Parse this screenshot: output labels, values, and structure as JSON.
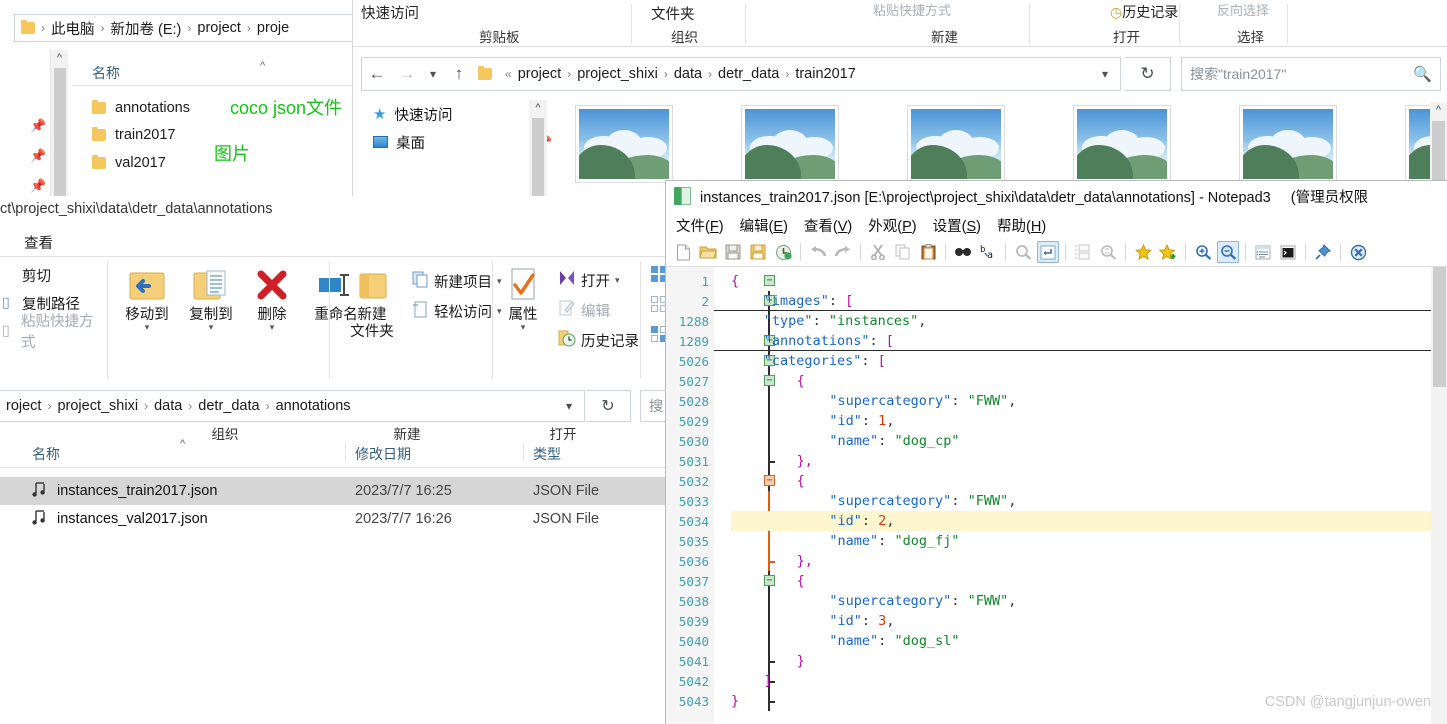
{
  "window1": {
    "breadcrumb": [
      "此电脑",
      "新加卷 (E:)",
      "project",
      "proje"
    ],
    "column_header": "名称",
    "items": [
      {
        "name": "annotations"
      },
      {
        "name": "train2017"
      },
      {
        "name": "val2017"
      }
    ],
    "annotations": [
      {
        "text": "coco json文件",
        "color": "#14c414"
      },
      {
        "text": "图片",
        "color": "#14c414"
      }
    ]
  },
  "window2": {
    "ribbon": {
      "quick_access": "快速访问",
      "paste_shortcut": "粘贴快捷方式",
      "groups": [
        "剪贴板",
        "组织",
        "新建",
        "打开",
        "选择"
      ],
      "folder_label": "文件夹",
      "history_label": "历史记录",
      "invert_label": "反向选择"
    },
    "breadcrumb": [
      "project",
      "project_shixi",
      "data",
      "detr_data",
      "train2017"
    ],
    "search_placeholder": "搜索\"train2017\"",
    "nav": [
      {
        "label": "快速访问",
        "icon": "star-icon"
      },
      {
        "label": "桌面",
        "icon": "desktop-icon"
      }
    ],
    "thumbnail_count": 6
  },
  "window3": {
    "title_path": "ct\\project_shixi\\data\\detr_data\\annotations",
    "tab": "查看",
    "clipboard": [
      {
        "label": "剪切",
        "enabled": true
      },
      {
        "label": "复制路径",
        "enabled": true
      },
      {
        "label": "粘贴快捷方式",
        "enabled": false
      }
    ],
    "big_buttons": [
      {
        "label": "移动到",
        "icon": "move-to-icon",
        "caret": true
      },
      {
        "label": "复制到",
        "icon": "copy-to-icon",
        "caret": true
      },
      {
        "label": "删除",
        "icon": "delete-icon",
        "caret": true
      },
      {
        "label": "重命名",
        "icon": "rename-icon",
        "caret": false
      },
      {
        "label": "新建\n文件夹",
        "icon": "new-folder-icon",
        "caret": false
      },
      {
        "label": "属性",
        "icon": "properties-icon",
        "caret": true
      }
    ],
    "new_items": [
      {
        "label": "新建项目",
        "icon": "new-item-icon",
        "enabled": true,
        "caret": true
      },
      {
        "label": "轻松访问",
        "icon": "easy-access-icon",
        "enabled": true,
        "caret": true
      }
    ],
    "open_items": [
      {
        "label": "打开",
        "icon": "open-icon",
        "enabled": true,
        "caret": true
      },
      {
        "label": "编辑",
        "icon": "edit-icon",
        "enabled": false,
        "caret": false
      },
      {
        "label": "历史记录",
        "icon": "history-icon",
        "enabled": true,
        "caret": false
      }
    ],
    "group_labels": [
      "组织",
      "新建",
      "打开"
    ],
    "breadcrumb": [
      "roject",
      "project_shixi",
      "data",
      "detr_data",
      "annotations"
    ],
    "search_placeholder": "搜",
    "columns": [
      "名称",
      "修改日期",
      "类型"
    ],
    "rows": [
      {
        "name": "instances_train2017.json",
        "modified": "2023/7/7 16:25",
        "type": "JSON File",
        "selected": true
      },
      {
        "name": "instances_val2017.json",
        "modified": "2023/7/7 16:26",
        "type": "JSON File",
        "selected": false
      }
    ]
  },
  "notepad": {
    "title": "instances_train2017.json [E:\\project\\project_shixi\\data\\detr_data\\annotations] - Notepad3",
    "admin_suffix": "(管理员权限",
    "menus": [
      {
        "label": "文件",
        "accel": "F"
      },
      {
        "label": "编辑",
        "accel": "E"
      },
      {
        "label": "查看",
        "accel": "V"
      },
      {
        "label": "外观",
        "accel": "P"
      },
      {
        "label": "设置",
        "accel": "S"
      },
      {
        "label": "帮助",
        "accel": "H"
      }
    ],
    "toolbar_icons": [
      "new-file-icon",
      "open-file-icon",
      "save-icon",
      "save-as-icon",
      "revert-icon",
      "sep",
      "undo-icon",
      "redo-icon",
      "sep",
      "cut-icon",
      "copy-icon",
      "paste-icon",
      "sep",
      "find-icon",
      "replace-icon",
      "sep",
      "find-next-icon",
      "toggle-eol-icon",
      "sep",
      "block-select-icon",
      "zoom-find-icon",
      "sep",
      "bookmark-icon",
      "add-bookmark-icon",
      "sep",
      "zoom-in-icon",
      "zoom-out-icon",
      "sep",
      "word-wrap-icon",
      "console-icon",
      "sep",
      "always-on-top-icon",
      "sep",
      "exit-icon"
    ],
    "active_toolbar_icons": [
      "toggle-eol-icon",
      "zoom-out-icon"
    ],
    "lines": [
      {
        "num": "1",
        "indent": 0,
        "fold": "minus",
        "tokens": [
          {
            "t": "{",
            "c": "brace"
          }
        ]
      },
      {
        "num": "2",
        "indent": 1,
        "fold": "plus",
        "tokens": [
          {
            "t": "\"images\"",
            "c": "key"
          },
          {
            "t": ": ",
            "c": "punc"
          },
          {
            "t": "[",
            "c": "brace"
          }
        ],
        "rule_below": true
      },
      {
        "num": "1288",
        "indent": 1,
        "fold": "none",
        "tokens": [
          {
            "t": "\"type\"",
            "c": "key"
          },
          {
            "t": ": ",
            "c": "punc"
          },
          {
            "t": "\"instances\"",
            "c": "str"
          },
          {
            "t": ",",
            "c": "punc"
          }
        ]
      },
      {
        "num": "1289",
        "indent": 1,
        "fold": "plus",
        "tokens": [
          {
            "t": "\"annotations\"",
            "c": "key"
          },
          {
            "t": ": ",
            "c": "punc"
          },
          {
            "t": "[",
            "c": "brace"
          }
        ],
        "rule_below": true
      },
      {
        "num": "5026",
        "indent": 1,
        "fold": "minus",
        "tokens": [
          {
            "t": "\"categories\"",
            "c": "key"
          },
          {
            "t": ": ",
            "c": "punc"
          },
          {
            "t": "[",
            "c": "brace"
          }
        ]
      },
      {
        "num": "5027",
        "indent": 2,
        "fold": "minus",
        "tokens": [
          {
            "t": "{",
            "c": "brace"
          }
        ]
      },
      {
        "num": "5028",
        "indent": 3,
        "fold": "none",
        "tokens": [
          {
            "t": "\"supercategory\"",
            "c": "key"
          },
          {
            "t": ": ",
            "c": "punc"
          },
          {
            "t": "\"FWW\"",
            "c": "str"
          },
          {
            "t": ",",
            "c": "punc"
          }
        ]
      },
      {
        "num": "5029",
        "indent": 3,
        "fold": "none",
        "tokens": [
          {
            "t": "\"id\"",
            "c": "key"
          },
          {
            "t": ": ",
            "c": "punc"
          },
          {
            "t": "1",
            "c": "num"
          },
          {
            "t": ",",
            "c": "punc"
          }
        ]
      },
      {
        "num": "5030",
        "indent": 3,
        "fold": "none",
        "tokens": [
          {
            "t": "\"name\"",
            "c": "key"
          },
          {
            "t": ": ",
            "c": "punc"
          },
          {
            "t": "\"dog_cp\"",
            "c": "str"
          }
        ]
      },
      {
        "num": "5031",
        "indent": 2,
        "fold": "tick",
        "tokens": [
          {
            "t": "},",
            "c": "brace"
          }
        ]
      },
      {
        "num": "5032",
        "indent": 2,
        "fold": "minus-orange",
        "tokens": [
          {
            "t": "{",
            "c": "brace"
          }
        ]
      },
      {
        "num": "5033",
        "indent": 3,
        "fold": "none",
        "tokens": [
          {
            "t": "\"supercategory\"",
            "c": "key"
          },
          {
            "t": ": ",
            "c": "punc"
          },
          {
            "t": "\"FWW\"",
            "c": "str"
          },
          {
            "t": ",",
            "c": "punc"
          }
        ]
      },
      {
        "num": "5034",
        "indent": 3,
        "fold": "none",
        "highlight": true,
        "tokens": [
          {
            "t": "\"id\"",
            "c": "key"
          },
          {
            "t": ": ",
            "c": "punc"
          },
          {
            "t": "2",
            "c": "num"
          },
          {
            "t": ",",
            "c": "punc"
          }
        ]
      },
      {
        "num": "5035",
        "indent": 3,
        "fold": "none",
        "tokens": [
          {
            "t": "\"name\"",
            "c": "key"
          },
          {
            "t": ": ",
            "c": "punc"
          },
          {
            "t": "\"dog_fj\"",
            "c": "str"
          }
        ]
      },
      {
        "num": "5036",
        "indent": 2,
        "fold": "tick-orange",
        "tokens": [
          {
            "t": "},",
            "c": "brace"
          }
        ]
      },
      {
        "num": "5037",
        "indent": 2,
        "fold": "minus",
        "tokens": [
          {
            "t": "{",
            "c": "brace"
          }
        ]
      },
      {
        "num": "5038",
        "indent": 3,
        "fold": "none",
        "tokens": [
          {
            "t": "\"supercategory\"",
            "c": "key"
          },
          {
            "t": ": ",
            "c": "punc"
          },
          {
            "t": "\"FWW\"",
            "c": "str"
          },
          {
            "t": ",",
            "c": "punc"
          }
        ]
      },
      {
        "num": "5039",
        "indent": 3,
        "fold": "none",
        "tokens": [
          {
            "t": "\"id\"",
            "c": "key"
          },
          {
            "t": ": ",
            "c": "punc"
          },
          {
            "t": "3",
            "c": "num"
          },
          {
            "t": ",",
            "c": "punc"
          }
        ]
      },
      {
        "num": "5040",
        "indent": 3,
        "fold": "none",
        "tokens": [
          {
            "t": "\"name\"",
            "c": "key"
          },
          {
            "t": ": ",
            "c": "punc"
          },
          {
            "t": "\"dog_sl\"",
            "c": "str"
          }
        ]
      },
      {
        "num": "5041",
        "indent": 2,
        "fold": "tick",
        "tokens": [
          {
            "t": "}",
            "c": "brace"
          }
        ]
      },
      {
        "num": "5042",
        "indent": 1,
        "fold": "tick",
        "tokens": [
          {
            "t": "]",
            "c": "brace"
          }
        ]
      },
      {
        "num": "5043",
        "indent": 0,
        "fold": "end",
        "tokens": [
          {
            "t": "}",
            "c": "brace"
          }
        ]
      }
    ]
  },
  "watermark": "CSDN @tangjunjun-owen"
}
